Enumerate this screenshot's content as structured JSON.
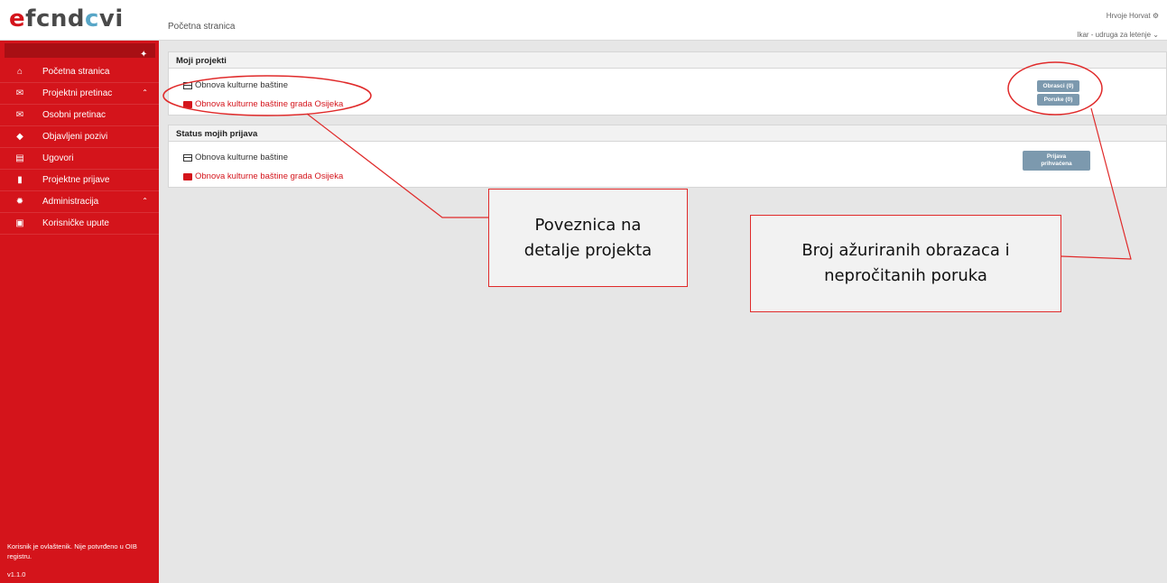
{
  "header": {
    "logo_part1": "e",
    "logo_part2": "fc",
    "logo_part3": "nd",
    "logo_part4": "c",
    "logo_part5": "vi",
    "breadcrumb": "Početna stranica",
    "user_name": "Hrvoje Horvat",
    "organization": "Ikar - udruga za letenje"
  },
  "sidebar": {
    "items": [
      {
        "label": "Početna stranica",
        "icon": "home-icon"
      },
      {
        "label": "Projektni pretinac",
        "icon": "envelope-icon"
      },
      {
        "label": "Osobni pretinac",
        "icon": "envelope-icon"
      },
      {
        "label": "Objavljeni pozivi",
        "icon": "tags-icon"
      },
      {
        "label": "Ugovori",
        "icon": "list-icon"
      },
      {
        "label": "Projektne prijave",
        "icon": "bookmark-icon"
      },
      {
        "label": "Administracija",
        "icon": "gear-icon"
      },
      {
        "label": "Korisničke upute",
        "icon": "pdf-icon"
      }
    ],
    "footer_note": "Korisnik je ovlaštenik. Nije potvrđeno u OIB registru.",
    "version": "v1.1.0"
  },
  "projects_panel": {
    "title": "Moji projekti",
    "project_1": "Obnova kulturne baštine",
    "project_2": "Obnova kulturne baštine grada Osijeka",
    "forms_badge": "Obrasci (0)",
    "messages_badge": "Poruke (0)"
  },
  "status_panel": {
    "title": "Status mojih prijava",
    "project_1": "Obnova kulturne baštine",
    "project_2": "Obnova kulturne baštine grada Osijeka",
    "status_line1": "Prijava",
    "status_line2": "prihvaćena"
  },
  "annotations": {
    "callout_1_line1": "Poveznica na",
    "callout_1_line2": "detalje projekta",
    "callout_2_line1": "Broj ažuriranih obrazaca i",
    "callout_2_line2": "nepročitanih poruka"
  },
  "colors": {
    "brand_red": "#d4141b",
    "badge_blue": "#7c99ae",
    "annotation_red": "#e02a2a"
  }
}
